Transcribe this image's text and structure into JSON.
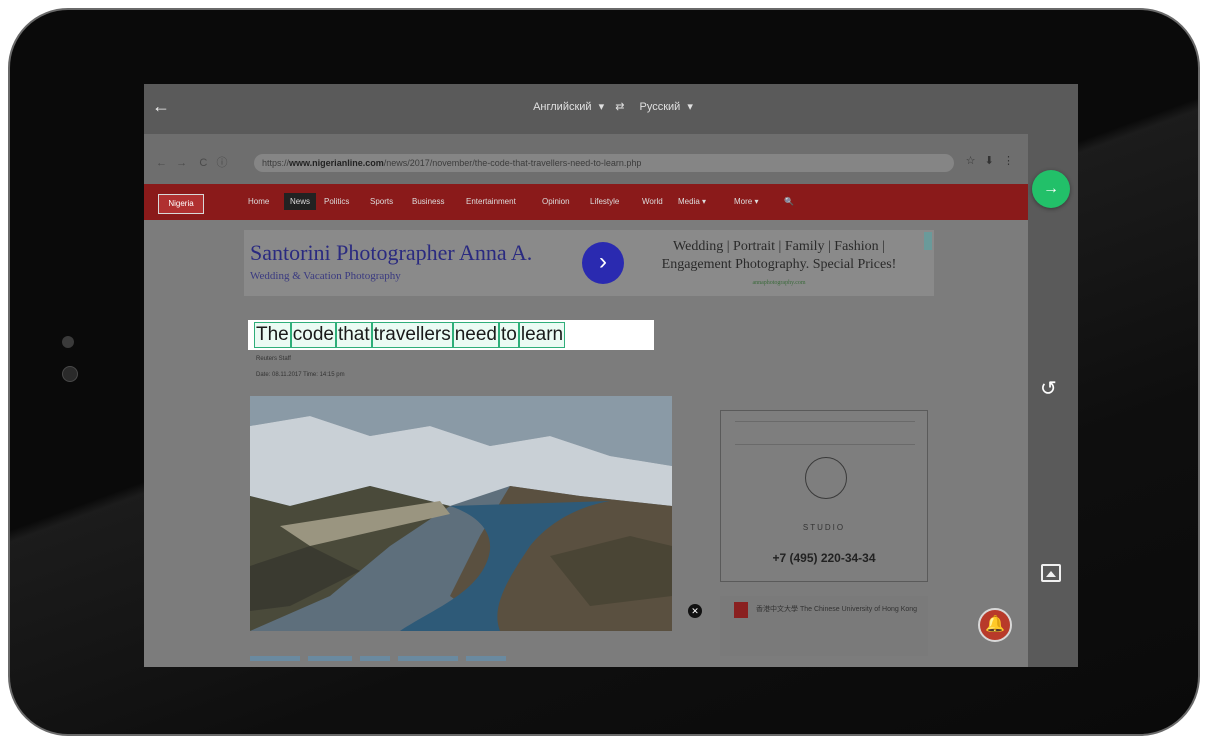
{
  "translator": {
    "source_language": "Английский",
    "swap_label": "⇄",
    "target_language": "Русский",
    "back_label": "←"
  },
  "browser": {
    "url_prefix": "https://",
    "url_domain": "www.nigerianline.com",
    "url_path": "/news/2017/november/the-code-that-travellers-need-to-learn.php",
    "nav_back": "←",
    "nav_forward": "→",
    "reload": "C",
    "info": "ⓘ",
    "star": "☆",
    "download": "⬇",
    "menu": "⋮"
  },
  "site": {
    "logo": "Nigeria",
    "nav": [
      "Home",
      "News",
      "Politics",
      "Sports",
      "Business",
      "Entertainment",
      "Opinion",
      "Lifestyle",
      "World",
      "Media ▾",
      "More ▾",
      "🔍"
    ]
  },
  "ad_banner": {
    "title": "Santorini Photographer Anna A.",
    "subtitle": "Wedding & Vacation Photography",
    "arrow": "›",
    "right_line1": "Wedding | Portrait | Family | Fashion |",
    "right_line2": "Engagement Photography. Special Prices!",
    "right_url": "annaphotography.com"
  },
  "article": {
    "headline_words": [
      "The",
      "code",
      "that",
      "travellers",
      "need",
      "to",
      "learn"
    ],
    "byline": "Reuters Staff",
    "dateline": "Date: 08.11.2017  Time: 14:15 pm"
  },
  "side_ad": {
    "brand": "STUDIO",
    "phone": "+7 (495) 220-34-34"
  },
  "side_ad2": {
    "text": "香港中文大學  The Chinese University of Hong Kong"
  },
  "buttons": {
    "go": "→",
    "rotate": "↺",
    "close_ad": "✕",
    "notification": "🔔"
  }
}
